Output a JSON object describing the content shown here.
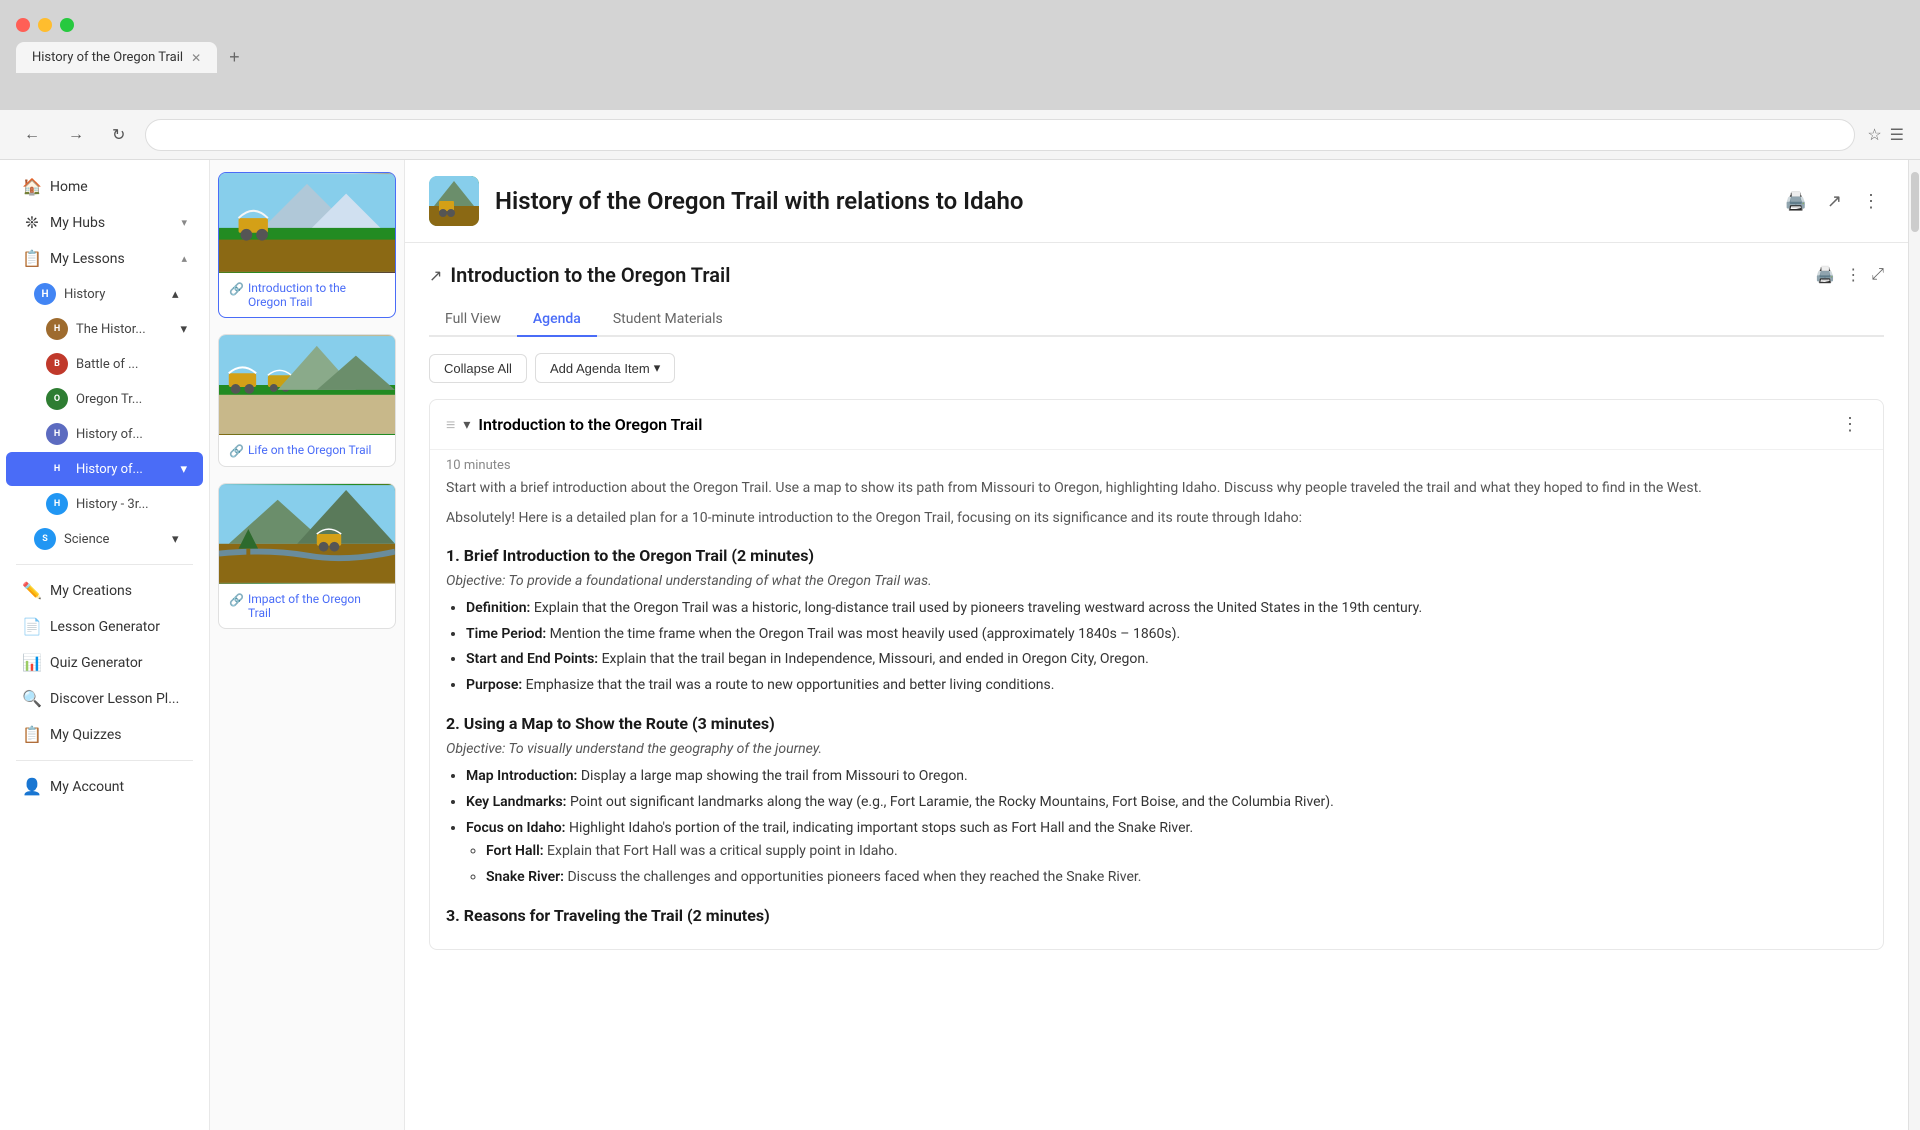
{
  "browser": {
    "tab_title": "History of the Oregon Trail",
    "new_tab_label": "+"
  },
  "nav": {
    "back_title": "Back",
    "forward_title": "Forward",
    "refresh_title": "Refresh",
    "bookmark_title": "Bookmark",
    "menu_title": "Menu"
  },
  "sidebar": {
    "home_label": "Home",
    "my_hubs_label": "My Hubs",
    "my_lessons_label": "My Lessons",
    "history_label": "History",
    "history_sub_items": [
      {
        "label": "The Histor...",
        "color": "#9e6b2e"
      },
      {
        "label": "Battle of ...",
        "color": "#c0392b"
      },
      {
        "label": "Oregon Tr...",
        "color": "#2e7d32"
      },
      {
        "label": "History of...",
        "color": "#5c6bc0"
      },
      {
        "label": "History of...",
        "color": "#4a6cf7",
        "active": true
      },
      {
        "label": "History - 3r...",
        "color": "#2196f3"
      }
    ],
    "science_label": "Science",
    "my_creations_label": "My Creations",
    "lesson_generator_label": "Lesson Generator",
    "quiz_generator_label": "Quiz Generator",
    "discover_label": "Discover Lesson Pl...",
    "my_quizzes_label": "My Quizzes",
    "my_account_label": "My Account"
  },
  "lesson_list": {
    "cards": [
      {
        "link_text": "Introduction to the Oregon Trail",
        "active": true
      },
      {
        "link_text": "Life on the Oregon Trail",
        "active": false
      },
      {
        "link_text": "Impact of the Oregon Trail",
        "active": false
      }
    ]
  },
  "page": {
    "title": "History of the Oregon Trail with relations to Idaho",
    "print_title": "Print",
    "share_title": "Share",
    "more_title": "More options"
  },
  "lesson_header": {
    "title": "Introduction to the Oregon Trail",
    "print_title": "Print",
    "more_title": "More",
    "expand_title": "Expand"
  },
  "tabs": {
    "items": [
      {
        "label": "Full View",
        "active": false
      },
      {
        "label": "Agenda",
        "active": true
      },
      {
        "label": "Student Materials",
        "active": false
      }
    ]
  },
  "toolbar": {
    "collapse_all_label": "Collapse All",
    "add_item_label": "Add Agenda Item",
    "add_item_chevron": "▾"
  },
  "agenda": {
    "drag_handle": "≡",
    "collapse_icon": "▾",
    "item_title": "Introduction to the Oregon Trail",
    "more_icon": "⋮",
    "time": "10 minutes",
    "description": "Start with a brief introduction about the Oregon Trail. Use a map to show its path from Missouri to Oregon, highlighting Idaho. Discuss why people traveled the trail and what they hoped to find in the West.",
    "note": "Absolutely! Here is a detailed plan for a 10-minute introduction to the Oregon Trail, focusing on its significance and its route through Idaho:",
    "sections": [
      {
        "title": "1. Brief Introduction to the Oregon Trail (2 minutes)",
        "objective": "Objective: To provide a foundational understanding of what the Oregon Trail was.",
        "items": [
          {
            "label": "Definition:",
            "text": "Explain that the Oregon Trail was a historic, long-distance trail used by pioneers traveling westward across the United States in the 19th century."
          },
          {
            "label": "Time Period:",
            "text": "Mention the time frame when the Oregon Trail was most heavily used (approximately 1840s – 1860s)."
          },
          {
            "label": "Start and End Points:",
            "text": "Explain that the trail began in Independence, Missouri, and ended in Oregon City, Oregon."
          },
          {
            "label": "Purpose:",
            "text": "Emphasize that the trail was a route to new opportunities and better living conditions."
          }
        ]
      },
      {
        "title": "2. Using a Map to Show the Route (3 minutes)",
        "objective": "Objective: To visually understand the geography of the journey.",
        "items": [
          {
            "label": "Map Introduction:",
            "text": "Display a large map showing the trail from Missouri to Oregon."
          },
          {
            "label": "Key Landmarks:",
            "text": "Point out significant landmarks along the way (e.g., Fort Laramie, the Rocky Mountains, Fort Boise, and the Columbia River)."
          },
          {
            "label": "Focus on Idaho:",
            "text": "Highlight Idaho's portion of the trail, indicating important stops such as Fort Hall and the Snake River.",
            "subitems": [
              {
                "label": "Fort Hall:",
                "text": "Explain that Fort Hall was a critical supply point in Idaho."
              },
              {
                "label": "Snake River:",
                "text": "Discuss the challenges and opportunities pioneers faced when they reached the Snake River."
              }
            ]
          }
        ]
      },
      {
        "title": "3. Reasons for Traveling the Trail (2 minutes)",
        "objective": "",
        "items": []
      }
    ]
  }
}
